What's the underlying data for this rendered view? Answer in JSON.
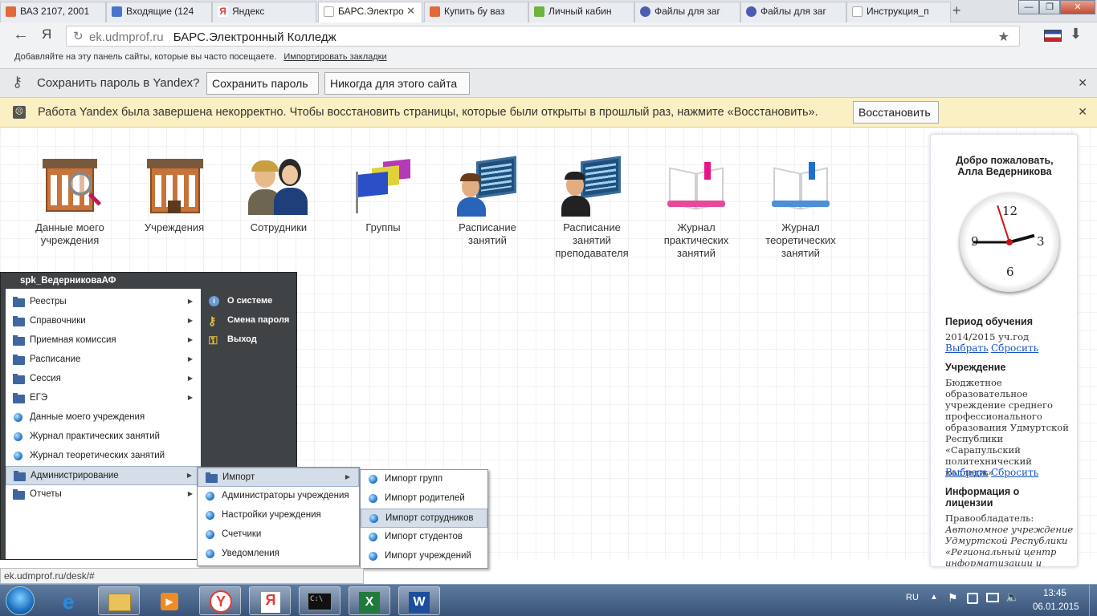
{
  "browser": {
    "tabs": [
      {
        "label": "ВАЗ 2107, 2001",
        "color": "#e06a3a"
      },
      {
        "label": "Входящие (124",
        "color": "#4a74c9"
      },
      {
        "label": "Яндекс",
        "color": "#e53935"
      },
      {
        "label": "БАРС.Электро",
        "color": "#9aa3ad"
      },
      {
        "label": "Купить бу ваз",
        "color": "#e06a3a"
      },
      {
        "label": "Личный кабин",
        "color": "#6cb33f"
      },
      {
        "label": "Файлы для заг",
        "color": "#4d5bb0"
      },
      {
        "label": "Файлы для заг",
        "color": "#4d5bb0"
      },
      {
        "label": "Инструкция_п",
        "color": "#9aa3ad"
      }
    ],
    "new_tab": "+",
    "window_controls": [
      "—",
      "❐",
      "✕"
    ],
    "address": {
      "domain": "ek.udmprof.ru",
      "title": "БАРС.Электронный Колледж"
    },
    "bookmarks_bar": {
      "text": "Добавляйте на эту панель сайты, которые вы часто посещаете.",
      "import_link": "Импортировать закладки"
    },
    "password_bar": {
      "text": "Сохранить пароль в Yandex?",
      "save": "Сохранить пароль",
      "never": "Никогда для этого сайта"
    },
    "crash_bar": {
      "text": "Работа Yandex была завершена некорректно. Чтобы восстановить страницы, которые были открыты в прошлый раз, нажмите «Восстановить».",
      "restore": "Восстановить"
    },
    "status_url": "ek.udmprof.ru/desk/#"
  },
  "desktop_icons": [
    {
      "label": "Данные моего учреждения"
    },
    {
      "label": "Учреждения"
    },
    {
      "label": "Сотрудники"
    },
    {
      "label": "Группы"
    },
    {
      "label": "Расписание занятий"
    },
    {
      "label": "Расписание занятий преподавателя"
    },
    {
      "label": "Журнал практических занятий"
    },
    {
      "label": "Журнал теоретических занятий"
    }
  ],
  "side": {
    "welcome": "Добро пожаловать,",
    "user_name": "Алла Ведерникова",
    "clock": {
      "numbers": [
        "12",
        "3",
        "6",
        "9"
      ],
      "hour": 2.5,
      "minute": 45,
      "second": 57
    },
    "period_title": "Период обучения",
    "period_value": "2014/2015 уч.год",
    "choose": "Выбрать",
    "reset": "Сбросить",
    "org_title": "Учреждение",
    "org_value": "Бюджетное образовательное учреждение среднего профессионального образования Удмуртской Республики «Сарапульский политехнический колледж»",
    "license_title": "Информация о лицензии",
    "license_holder": "Правообладатель:",
    "license_value": "Автономное учреждение Удмуртской Республики «Региональный центр информатизации и оценки"
  },
  "start_menu": {
    "user": "spk_ВедерниковаАФ",
    "items": [
      {
        "label": "Реестры",
        "type": "folder",
        "sub": true
      },
      {
        "label": "Справочники",
        "type": "folder",
        "sub": true
      },
      {
        "label": "Приемная комиссия",
        "type": "folder",
        "sub": true
      },
      {
        "label": "Расписание",
        "type": "folder",
        "sub": true
      },
      {
        "label": "Сессия",
        "type": "folder",
        "sub": true
      },
      {
        "label": "ЕГЭ",
        "type": "folder",
        "sub": true
      },
      {
        "label": "Данные моего учреждения",
        "type": "dot",
        "sub": false
      },
      {
        "label": "Журнал практических занятий",
        "type": "dot",
        "sub": false
      },
      {
        "label": "Журнал теоретических занятий",
        "type": "dot",
        "sub": false
      },
      {
        "label": "Администрирование",
        "type": "folder",
        "sub": true,
        "selected": true
      },
      {
        "label": "Отчеты",
        "type": "folder",
        "sub": true
      }
    ],
    "right": [
      {
        "label": "О системе",
        "icon": "info-icon"
      },
      {
        "label": "Смена пароля",
        "icon": "key-change-icon"
      },
      {
        "label": "Выход",
        "icon": "exit-key-icon"
      }
    ],
    "admin_submenu": [
      {
        "label": "Импорт",
        "type": "folder",
        "sub": true,
        "selected": true
      },
      {
        "label": "Администраторы учреждения",
        "type": "dot"
      },
      {
        "label": "Настройки учреждения",
        "type": "dot"
      },
      {
        "label": "Счетчики",
        "type": "dot"
      },
      {
        "label": "Уведомления",
        "type": "dot"
      }
    ],
    "import_submenu": [
      {
        "label": "Импорт групп"
      },
      {
        "label": "Импорт родителей"
      },
      {
        "label": "Импорт сотрудников",
        "selected": true
      },
      {
        "label": "Импорт студентов"
      },
      {
        "label": "Импорт учреждений"
      }
    ]
  },
  "taskbar": {
    "lang": "RU",
    "time": "13:45",
    "date": "06.01.2015"
  }
}
